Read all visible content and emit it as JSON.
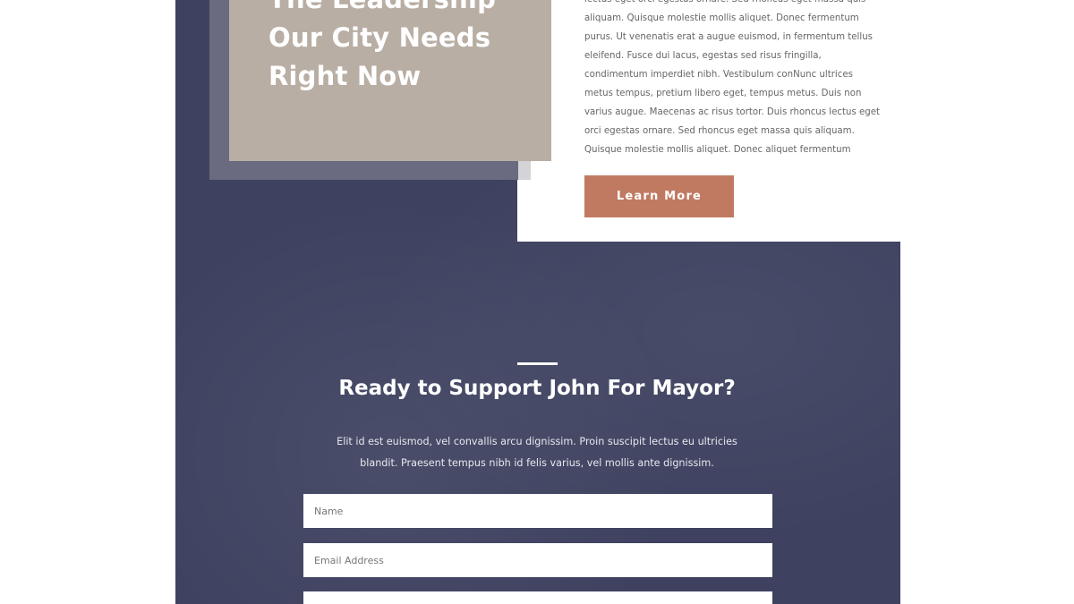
{
  "hero": {
    "headline_lines": [
      "The Leadership",
      "Our City Needs",
      "Right Now"
    ],
    "body_text": "lectus eget orci egestas ornare. Sed rhoncus eget massa quis aliquam. Quisque molestie mollis aliquet. Donec fermentum purus. Ut venenatis erat a augue euismod, in fermentum tellus eleifend. Fusce dui lacus, egestas sed risus fringilla, condimentum imperdiet nibh. Vestibulum conNunc ultrices metus tempus, pretium libero eget, tempus metus. Duis non varius augue. Maecenas ac risus tortor. Duis rhoncus lectus eget orci egestas ornare. Sed rhoncus eget massa quis aliquam. Quisque molestie mollis aliquet. Donec aliquet fermentum",
    "button_label": "Learn More"
  },
  "cta": {
    "title": "Ready to Support John For Mayor?",
    "text": "Elit id est euismod, vel convallis arcu dignissim. Proin suscipit lectus eu ultricies blandit. Praesent tempus nibh id felis varius, vel mollis ante dignissim."
  },
  "form": {
    "name_placeholder": "Name",
    "email_placeholder": "Email Address",
    "third_placeholder": ""
  },
  "colors": {
    "panel": "#3e4260",
    "title_box": "#b9aea4",
    "button": "#c07a62"
  }
}
